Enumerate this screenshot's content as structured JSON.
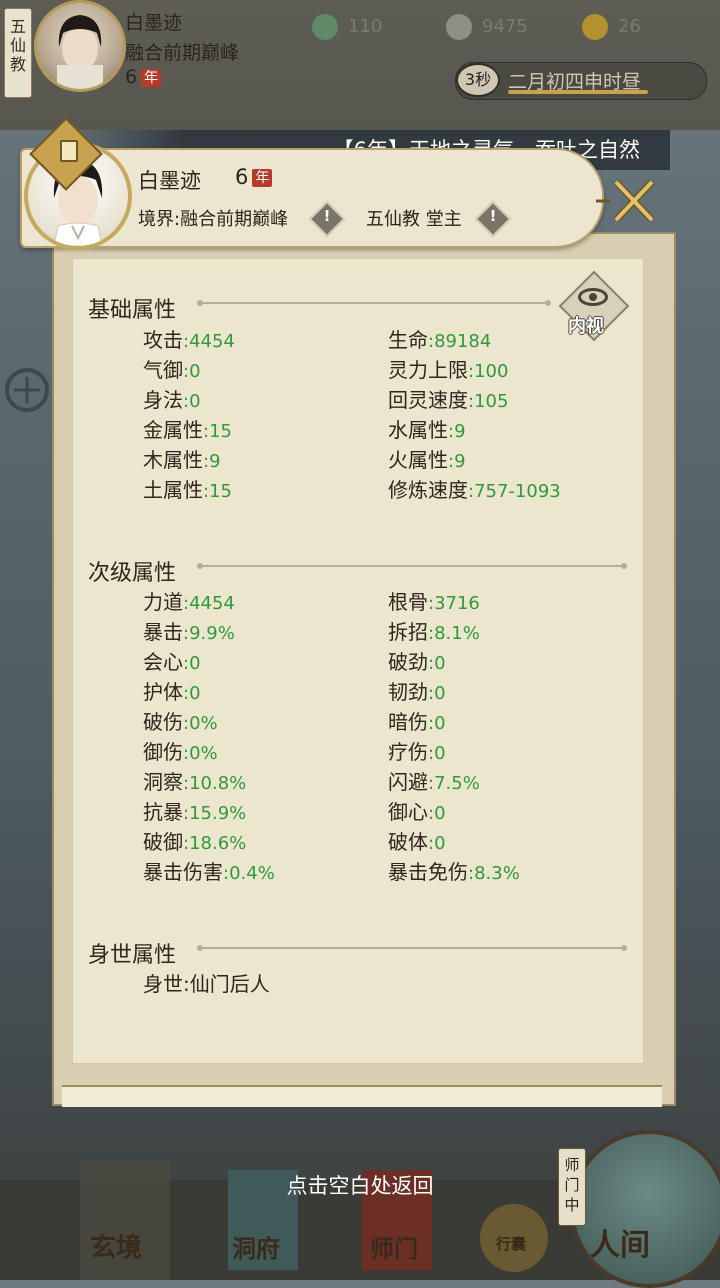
{
  "top_bar": {
    "sect_tag": "五仙教",
    "name": "白墨迹",
    "realm": "融合前期巅峰",
    "years": "6",
    "year_unit": "年",
    "resources": [
      {
        "icon": "jade-icon",
        "value": "110",
        "color": "#5e8a6a"
      },
      {
        "icon": "coin-icon",
        "value": "9475",
        "color": "#8f8f86"
      },
      {
        "icon": "strength-icon",
        "value": "26",
        "color": "#b3922e"
      }
    ],
    "time_seconds": "3秒",
    "date_text": "二月初四申时昼"
  },
  "notice": "【6年】天地之灵气，吞吐之自然",
  "profile": {
    "name": "白墨迹",
    "years": "6",
    "year_unit": "年",
    "realm_label": "境界:融合前期巅峰",
    "sect_label": "五仙教 堂主"
  },
  "neishi_label": "内视",
  "sections": {
    "basic": {
      "title": "基础属性",
      "left": [
        {
          "label": "攻击",
          "value": ":4454"
        },
        {
          "label": "气御",
          "value": ":0"
        },
        {
          "label": "身法",
          "value": ":0"
        },
        {
          "label": "金属性",
          "value": ":15"
        },
        {
          "label": "木属性",
          "value": ":9"
        },
        {
          "label": "土属性",
          "value": ":15"
        }
      ],
      "right": [
        {
          "label": "生命",
          "value": ":89184"
        },
        {
          "label": "灵力上限",
          "value": ":100"
        },
        {
          "label": "回灵速度",
          "value": ":105"
        },
        {
          "label": "水属性",
          "value": ":9"
        },
        {
          "label": "火属性",
          "value": ":9"
        },
        {
          "label": "修炼速度",
          "value": ":757-1093"
        }
      ]
    },
    "secondary": {
      "title": "次级属性",
      "left": [
        {
          "label": "力道",
          "value": ":4454"
        },
        {
          "label": "暴击",
          "value": ":9.9%"
        },
        {
          "label": "会心",
          "value": ":0"
        },
        {
          "label": "护体",
          "value": ":0"
        },
        {
          "label": "破伤",
          "value": ":0%"
        },
        {
          "label": "御伤",
          "value": ":0%"
        },
        {
          "label": "洞察",
          "value": ":10.8%"
        },
        {
          "label": "抗暴",
          "value": ":15.9%"
        },
        {
          "label": "破御",
          "value": ":18.6%"
        },
        {
          "label": "暴击伤害",
          "value": ":0.4%"
        }
      ],
      "right": [
        {
          "label": "根骨",
          "value": ":3716"
        },
        {
          "label": "拆招",
          "value": ":8.1%"
        },
        {
          "label": "破劲",
          "value": ":0"
        },
        {
          "label": "韧劲",
          "value": ":0"
        },
        {
          "label": "暗伤",
          "value": ":0"
        },
        {
          "label": "疗伤",
          "value": ":0"
        },
        {
          "label": "闪避",
          "value": ":7.5%"
        },
        {
          "label": "御心",
          "value": ":0"
        },
        {
          "label": "破体",
          "value": ":0"
        },
        {
          "label": "暴击免伤",
          "value": ":8.3%"
        }
      ]
    },
    "origin": {
      "title": "身世属性",
      "label": "身世",
      "value": ":仙门后人"
    }
  },
  "tap_hint": "点击空白处返回",
  "bottom_nav": {
    "items": [
      "玄境",
      "洞府",
      "师门",
      "行囊",
      "人间"
    ],
    "shimen_tag": "师门中"
  },
  "colors": {
    "value_green": "#2f9a3a",
    "panel_bg": "#ece6cf",
    "accent_gold": "#c6a85e"
  }
}
